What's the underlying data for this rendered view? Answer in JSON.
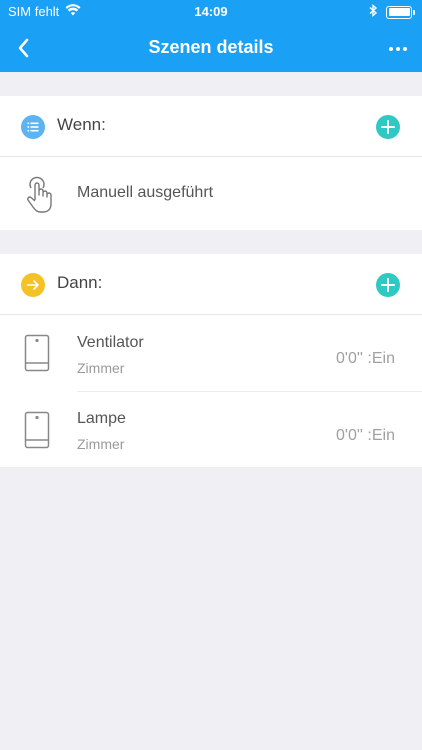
{
  "status_bar": {
    "carrier": "SIM fehlt",
    "time": "14:09"
  },
  "nav": {
    "title": "Szenen details"
  },
  "if_section": {
    "title": "Wenn:",
    "condition": "Manuell ausgeführt"
  },
  "then_section": {
    "title": "Dann:",
    "actions": [
      {
        "name": "Ventilator",
        "room": "Zimmer",
        "value": "0'0'' :Ein"
      },
      {
        "name": "Lampe",
        "room": "Zimmer",
        "value": "0'0'' :Ein"
      }
    ]
  },
  "colors": {
    "header": "#1aa0f5",
    "add_button": "#2ec9c3",
    "if_icon": "#5cb4f2",
    "then_icon": "#f5c225"
  }
}
